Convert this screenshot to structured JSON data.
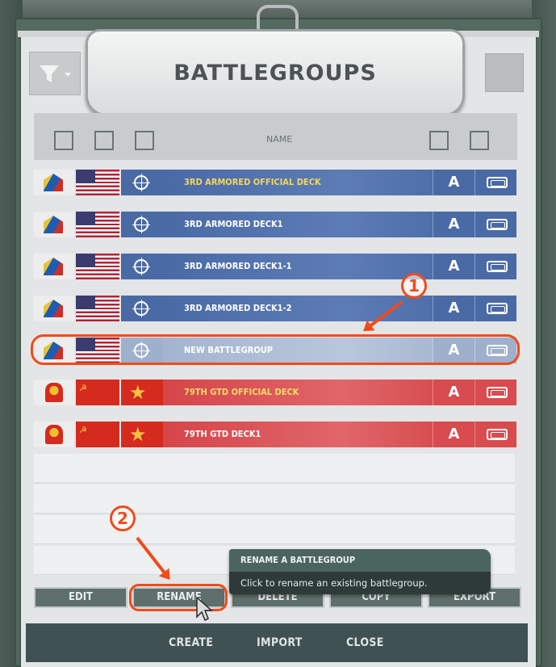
{
  "window": {
    "title": "BATTLEGROUPS"
  },
  "list_header": {
    "name_column": "NAME"
  },
  "battlegroups": [
    {
      "name": "3RD ARMORED OFFICIAL DECK",
      "grade": "A",
      "side": "nato"
    },
    {
      "name": "3RD ARMORED DECK1",
      "grade": "A",
      "side": "nato"
    },
    {
      "name": "3RD ARMORED DECK1-1",
      "grade": "A",
      "side": "nato"
    },
    {
      "name": "3RD ARMORED DECK1-2",
      "grade": "A",
      "side": "nato"
    },
    {
      "name": "NEW BATTLEGROUP",
      "grade": "A",
      "side": "nato",
      "selected": true
    },
    {
      "name": "79TH GTD OFFICIAL DECK",
      "grade": "A",
      "side": "pact"
    },
    {
      "name": "79TH GTD DECK1",
      "grade": "A",
      "side": "pact"
    }
  ],
  "annotations": {
    "marker_1": "1",
    "marker_2": "2"
  },
  "action_buttons": {
    "edit": "EDIT",
    "rename": "RENAME",
    "delete": "DELETE",
    "copy": "COPY",
    "export": "EXPORT"
  },
  "tooltip": {
    "title": "RENAME A BATTLEGROUP",
    "body": "Click to rename an existing battlegroup."
  },
  "bottom_bar": {
    "create": "CREATE",
    "import": "IMPORT",
    "close": "CLOSE"
  },
  "colors": {
    "nato_row": "#4a6aa6",
    "pact_row": "#d84b4e",
    "official_text": "#f3d75d",
    "annotation": "#f24a1a"
  }
}
